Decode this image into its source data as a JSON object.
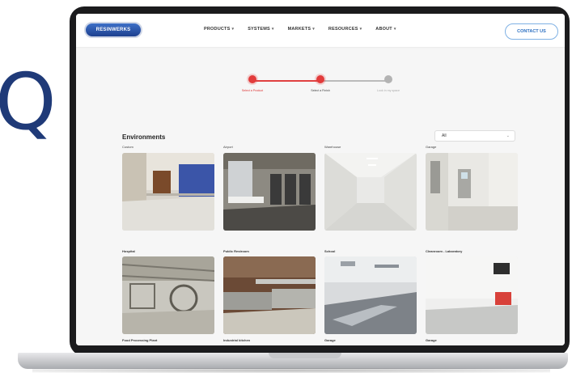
{
  "partial_letter": "Q",
  "navbar": {
    "logo_text": "RESINWERKS",
    "menu": [
      {
        "label": "PRODUCTS"
      },
      {
        "label": "SYSTEMS"
      },
      {
        "label": "MARKETS"
      },
      {
        "label": "RESOURCES"
      },
      {
        "label": "ABOUT"
      }
    ],
    "contact_label": "CONTACT US"
  },
  "stepper": {
    "steps": [
      {
        "label": "Select a Product",
        "state": "active"
      },
      {
        "label": "Select a Finish",
        "state": "active"
      },
      {
        "label": "Look in my space",
        "state": "inactive"
      }
    ]
  },
  "environments": {
    "title": "Environments",
    "filter_value": "All",
    "row1_top_labels": [
      "Custom",
      "Airport",
      "Warehouse",
      "Garage"
    ],
    "row1_bottom_labels": [
      "Hospital",
      "Public Restroom",
      "School",
      "Cleanroom - Laboratory"
    ],
    "row2_bottom_labels": [
      "Food Processing Plant",
      "Industrial kitchen",
      "Garage",
      "Garage"
    ]
  },
  "colors": {
    "brand_blue": "#1d3f8f",
    "accent_red": "#e23b3b",
    "contact_border": "#7fb1e4"
  }
}
